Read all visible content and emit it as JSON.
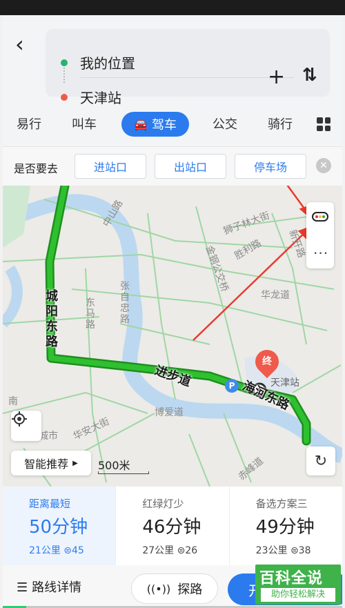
{
  "header": {
    "origin": "我的位置",
    "destination": "天津站"
  },
  "tabs": [
    {
      "label": "易行"
    },
    {
      "label": "叫车"
    },
    {
      "label": "驾车",
      "active": true
    },
    {
      "label": "公交"
    },
    {
      "label": "骑行"
    }
  ],
  "destination_prompt": {
    "question": "是否要去",
    "chips": [
      "进站口",
      "出站口",
      "停车场"
    ]
  },
  "map": {
    "road_labels": [
      "城阳东路",
      "进步道",
      "海河东路"
    ],
    "place_labels": [
      "狮子林大街",
      "胜利路",
      "金钢公交桥",
      "华龙道",
      "东马路",
      "张自忠路",
      "博爱道",
      "赤峰道",
      "南",
      "城市",
      "华安大街",
      "新开路",
      "中山路"
    ],
    "station_label": "天津站",
    "end_marker": "终",
    "parking_marker": "P",
    "smart_label": "智能推荐",
    "scale_label": "500米",
    "traffic_lights": [
      "#e53935",
      "#fbc02d",
      "#43a047"
    ]
  },
  "route_options": [
    {
      "name": "距离最短",
      "time": "50分钟",
      "distance": "21公里",
      "lights": "45",
      "selected": true
    },
    {
      "name": "红绿灯少",
      "time": "46分钟",
      "distance": "27公里",
      "lights": "26",
      "selected": false
    },
    {
      "name": "备选方案三",
      "time": "49分钟",
      "distance": "23公里",
      "lights": "38",
      "selected": false
    }
  ],
  "bottom": {
    "detail_label": "路线详情",
    "explore_label": "探路",
    "start_label": "开"
  },
  "progress": 0.07,
  "watermark": {
    "title": "百科全说",
    "subtitle": "助你轻松解决"
  },
  "colors": {
    "accent": "#2b7bee",
    "route": "#23a323",
    "annotation_arrow": "#e8392c"
  }
}
